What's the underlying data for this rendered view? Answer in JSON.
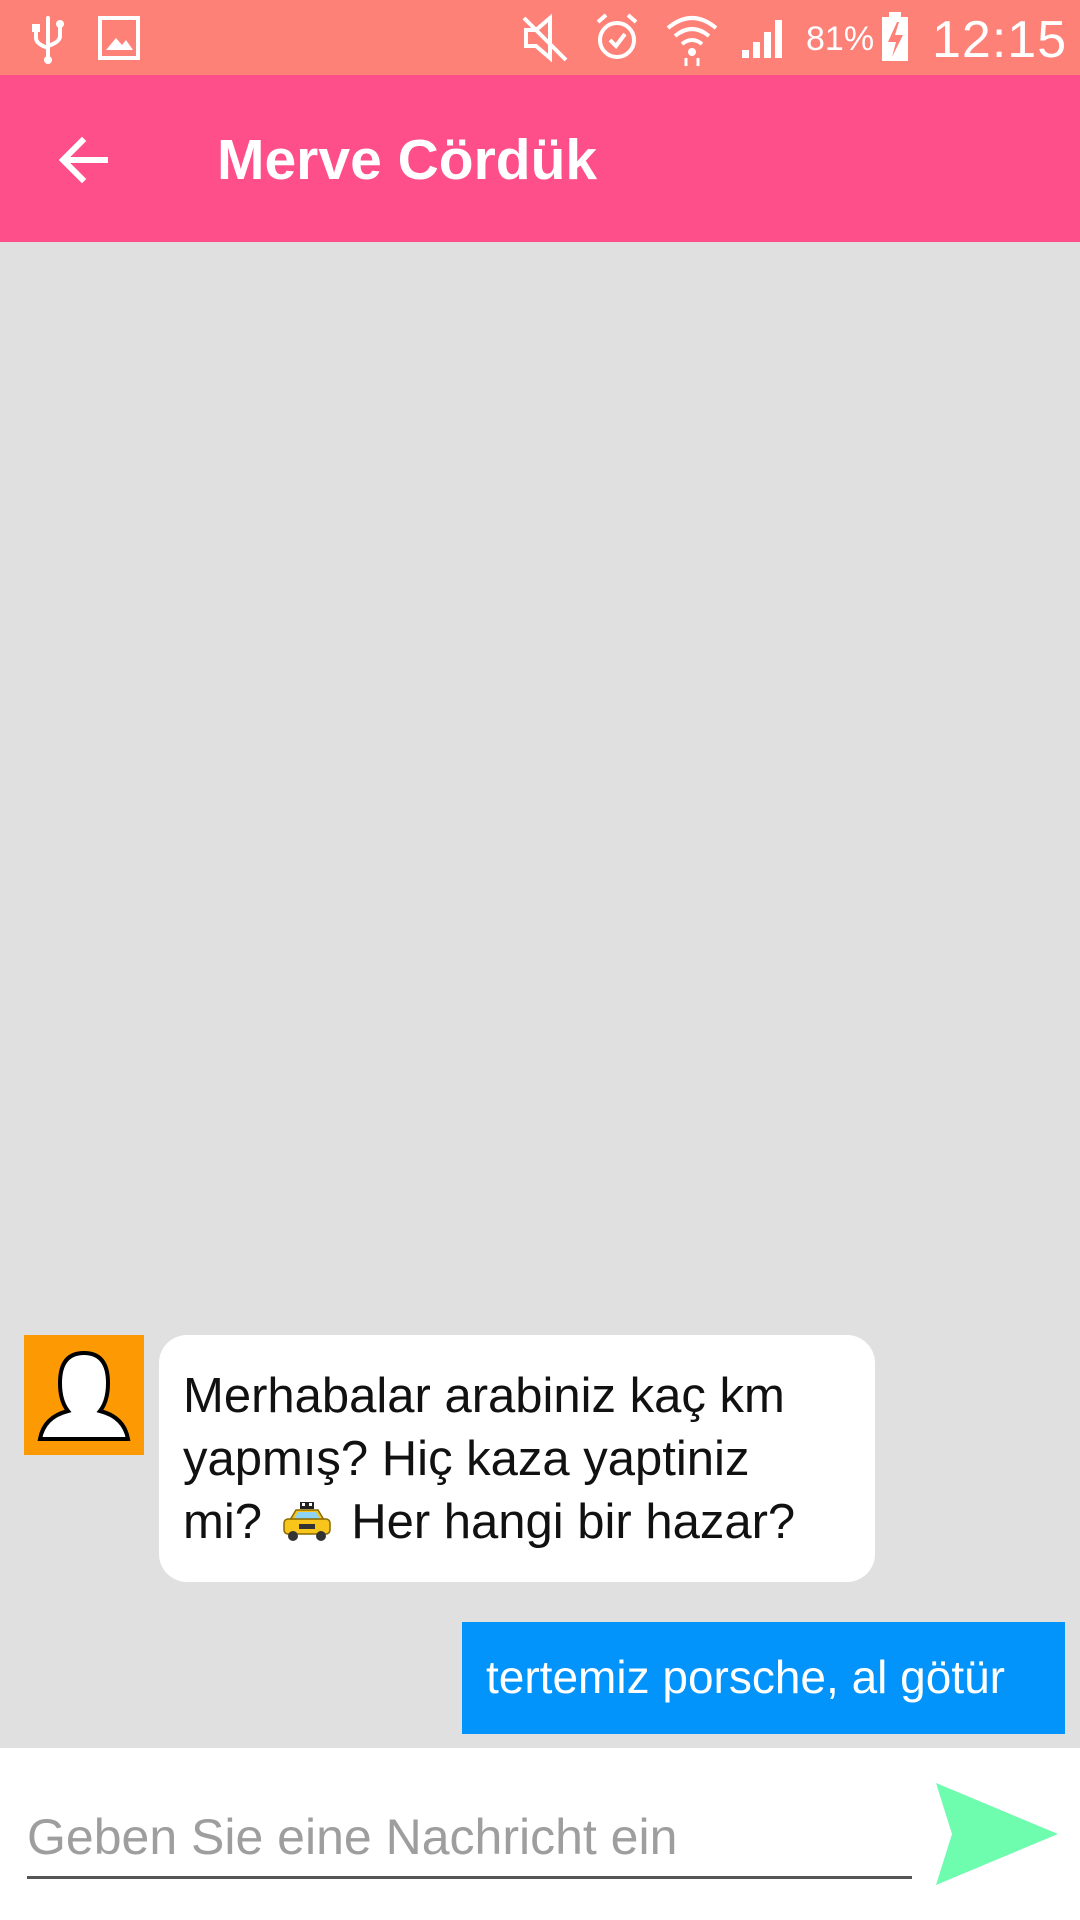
{
  "status_bar": {
    "icons": [
      "usb-icon",
      "image-icon",
      "mute-icon",
      "alarm-icon",
      "wifi-icon",
      "signal-icon",
      "battery-charging-icon"
    ],
    "battery_percent": "81%",
    "time": "12:15",
    "background_color": "#fe8178"
  },
  "app_bar": {
    "back_icon": "arrow-back-icon",
    "title": "Merve Cördük",
    "background_color": "#fe4f8b"
  },
  "chat": {
    "background_color": "#e0e0e0",
    "messages": [
      {
        "direction": "incoming",
        "avatar_icon": "person-silhouette-icon",
        "lines": [
          "Merhabalar arabiniz kaç km",
          "yapmış? Hiç kaza yaptiniz",
          "mi?",
          "Her hangi bir hazar?"
        ],
        "emoji_icon": "taxi-icon"
      },
      {
        "direction": "outgoing",
        "text": "tertemiz porsche, al götür",
        "bubble_color": "#0293fb"
      }
    ]
  },
  "composer": {
    "placeholder": "Geben Sie eine Nachricht ein",
    "value": "",
    "send_icon": "send-arrow-icon",
    "send_color": "#6efcaf"
  }
}
